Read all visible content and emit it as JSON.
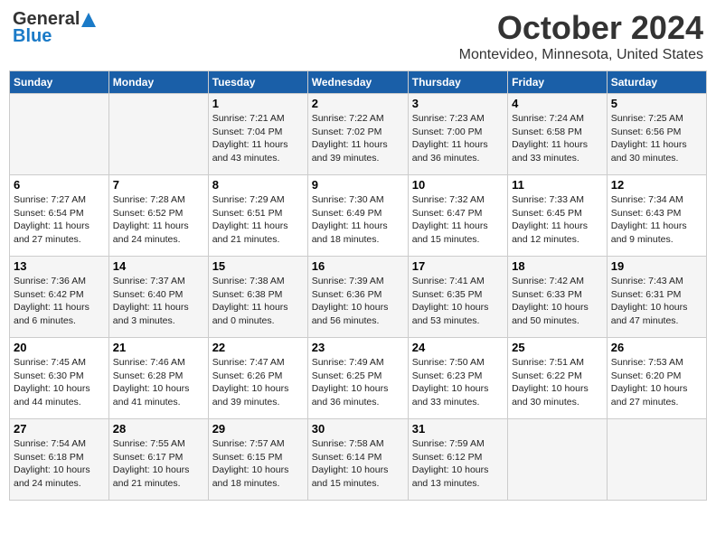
{
  "header": {
    "logo_general": "General",
    "logo_blue": "Blue",
    "month_title": "October 2024",
    "location": "Montevideo, Minnesota, United States"
  },
  "days_of_week": [
    "Sunday",
    "Monday",
    "Tuesday",
    "Wednesday",
    "Thursday",
    "Friday",
    "Saturday"
  ],
  "weeks": [
    [
      {
        "day": "",
        "info": ""
      },
      {
        "day": "",
        "info": ""
      },
      {
        "day": "1",
        "info": "Sunrise: 7:21 AM\nSunset: 7:04 PM\nDaylight: 11 hours and 43 minutes."
      },
      {
        "day": "2",
        "info": "Sunrise: 7:22 AM\nSunset: 7:02 PM\nDaylight: 11 hours and 39 minutes."
      },
      {
        "day": "3",
        "info": "Sunrise: 7:23 AM\nSunset: 7:00 PM\nDaylight: 11 hours and 36 minutes."
      },
      {
        "day": "4",
        "info": "Sunrise: 7:24 AM\nSunset: 6:58 PM\nDaylight: 11 hours and 33 minutes."
      },
      {
        "day": "5",
        "info": "Sunrise: 7:25 AM\nSunset: 6:56 PM\nDaylight: 11 hours and 30 minutes."
      }
    ],
    [
      {
        "day": "6",
        "info": "Sunrise: 7:27 AM\nSunset: 6:54 PM\nDaylight: 11 hours and 27 minutes."
      },
      {
        "day": "7",
        "info": "Sunrise: 7:28 AM\nSunset: 6:52 PM\nDaylight: 11 hours and 24 minutes."
      },
      {
        "day": "8",
        "info": "Sunrise: 7:29 AM\nSunset: 6:51 PM\nDaylight: 11 hours and 21 minutes."
      },
      {
        "day": "9",
        "info": "Sunrise: 7:30 AM\nSunset: 6:49 PM\nDaylight: 11 hours and 18 minutes."
      },
      {
        "day": "10",
        "info": "Sunrise: 7:32 AM\nSunset: 6:47 PM\nDaylight: 11 hours and 15 minutes."
      },
      {
        "day": "11",
        "info": "Sunrise: 7:33 AM\nSunset: 6:45 PM\nDaylight: 11 hours and 12 minutes."
      },
      {
        "day": "12",
        "info": "Sunrise: 7:34 AM\nSunset: 6:43 PM\nDaylight: 11 hours and 9 minutes."
      }
    ],
    [
      {
        "day": "13",
        "info": "Sunrise: 7:36 AM\nSunset: 6:42 PM\nDaylight: 11 hours and 6 minutes."
      },
      {
        "day": "14",
        "info": "Sunrise: 7:37 AM\nSunset: 6:40 PM\nDaylight: 11 hours and 3 minutes."
      },
      {
        "day": "15",
        "info": "Sunrise: 7:38 AM\nSunset: 6:38 PM\nDaylight: 11 hours and 0 minutes."
      },
      {
        "day": "16",
        "info": "Sunrise: 7:39 AM\nSunset: 6:36 PM\nDaylight: 10 hours and 56 minutes."
      },
      {
        "day": "17",
        "info": "Sunrise: 7:41 AM\nSunset: 6:35 PM\nDaylight: 10 hours and 53 minutes."
      },
      {
        "day": "18",
        "info": "Sunrise: 7:42 AM\nSunset: 6:33 PM\nDaylight: 10 hours and 50 minutes."
      },
      {
        "day": "19",
        "info": "Sunrise: 7:43 AM\nSunset: 6:31 PM\nDaylight: 10 hours and 47 minutes."
      }
    ],
    [
      {
        "day": "20",
        "info": "Sunrise: 7:45 AM\nSunset: 6:30 PM\nDaylight: 10 hours and 44 minutes."
      },
      {
        "day": "21",
        "info": "Sunrise: 7:46 AM\nSunset: 6:28 PM\nDaylight: 10 hours and 41 minutes."
      },
      {
        "day": "22",
        "info": "Sunrise: 7:47 AM\nSunset: 6:26 PM\nDaylight: 10 hours and 39 minutes."
      },
      {
        "day": "23",
        "info": "Sunrise: 7:49 AM\nSunset: 6:25 PM\nDaylight: 10 hours and 36 minutes."
      },
      {
        "day": "24",
        "info": "Sunrise: 7:50 AM\nSunset: 6:23 PM\nDaylight: 10 hours and 33 minutes."
      },
      {
        "day": "25",
        "info": "Sunrise: 7:51 AM\nSunset: 6:22 PM\nDaylight: 10 hours and 30 minutes."
      },
      {
        "day": "26",
        "info": "Sunrise: 7:53 AM\nSunset: 6:20 PM\nDaylight: 10 hours and 27 minutes."
      }
    ],
    [
      {
        "day": "27",
        "info": "Sunrise: 7:54 AM\nSunset: 6:18 PM\nDaylight: 10 hours and 24 minutes."
      },
      {
        "day": "28",
        "info": "Sunrise: 7:55 AM\nSunset: 6:17 PM\nDaylight: 10 hours and 21 minutes."
      },
      {
        "day": "29",
        "info": "Sunrise: 7:57 AM\nSunset: 6:15 PM\nDaylight: 10 hours and 18 minutes."
      },
      {
        "day": "30",
        "info": "Sunrise: 7:58 AM\nSunset: 6:14 PM\nDaylight: 10 hours and 15 minutes."
      },
      {
        "day": "31",
        "info": "Sunrise: 7:59 AM\nSunset: 6:12 PM\nDaylight: 10 hours and 13 minutes."
      },
      {
        "day": "",
        "info": ""
      },
      {
        "day": "",
        "info": ""
      }
    ]
  ]
}
